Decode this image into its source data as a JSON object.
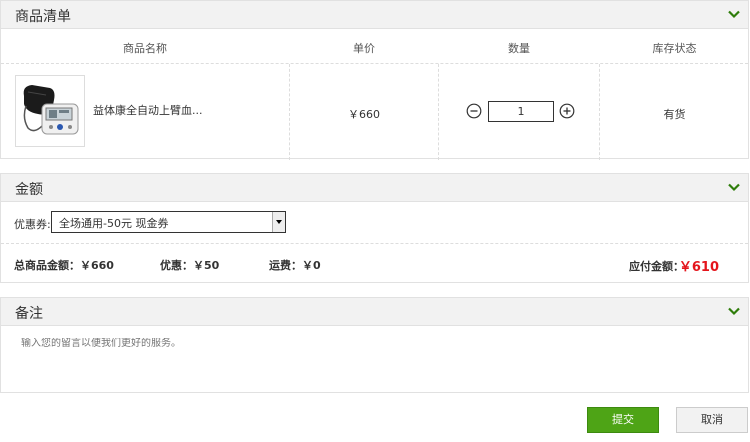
{
  "products_panel": {
    "title": "商品清单",
    "headers": {
      "name": "商品名称",
      "price": "单价",
      "quantity": "数量",
      "stock": "库存状态"
    },
    "item": {
      "name": "益体康全自动上臂血...",
      "price": "￥660",
      "quantity": "1",
      "stock": "有货"
    }
  },
  "amount_panel": {
    "title": "金额",
    "coupon_label": "优惠券:",
    "coupon_selected": "全场通用-50元 现金券",
    "total_label": "总商品金额：",
    "total_value": "￥660",
    "discount_label": "优惠：",
    "discount_value": "￥50",
    "shipping_label": "运费：",
    "shipping_value": "￥0",
    "payable_label": "应付金额：",
    "payable_value": "￥610",
    "payable_color": "#e4151c"
  },
  "remark_panel": {
    "title": "备注",
    "placeholder": "输入您的留言以便我们更好的服务。"
  },
  "actions": {
    "submit": "提交",
    "cancel": "取消"
  },
  "colors": {
    "accent_green": "#4ea416",
    "chevron_green": "#2e7d0a"
  }
}
